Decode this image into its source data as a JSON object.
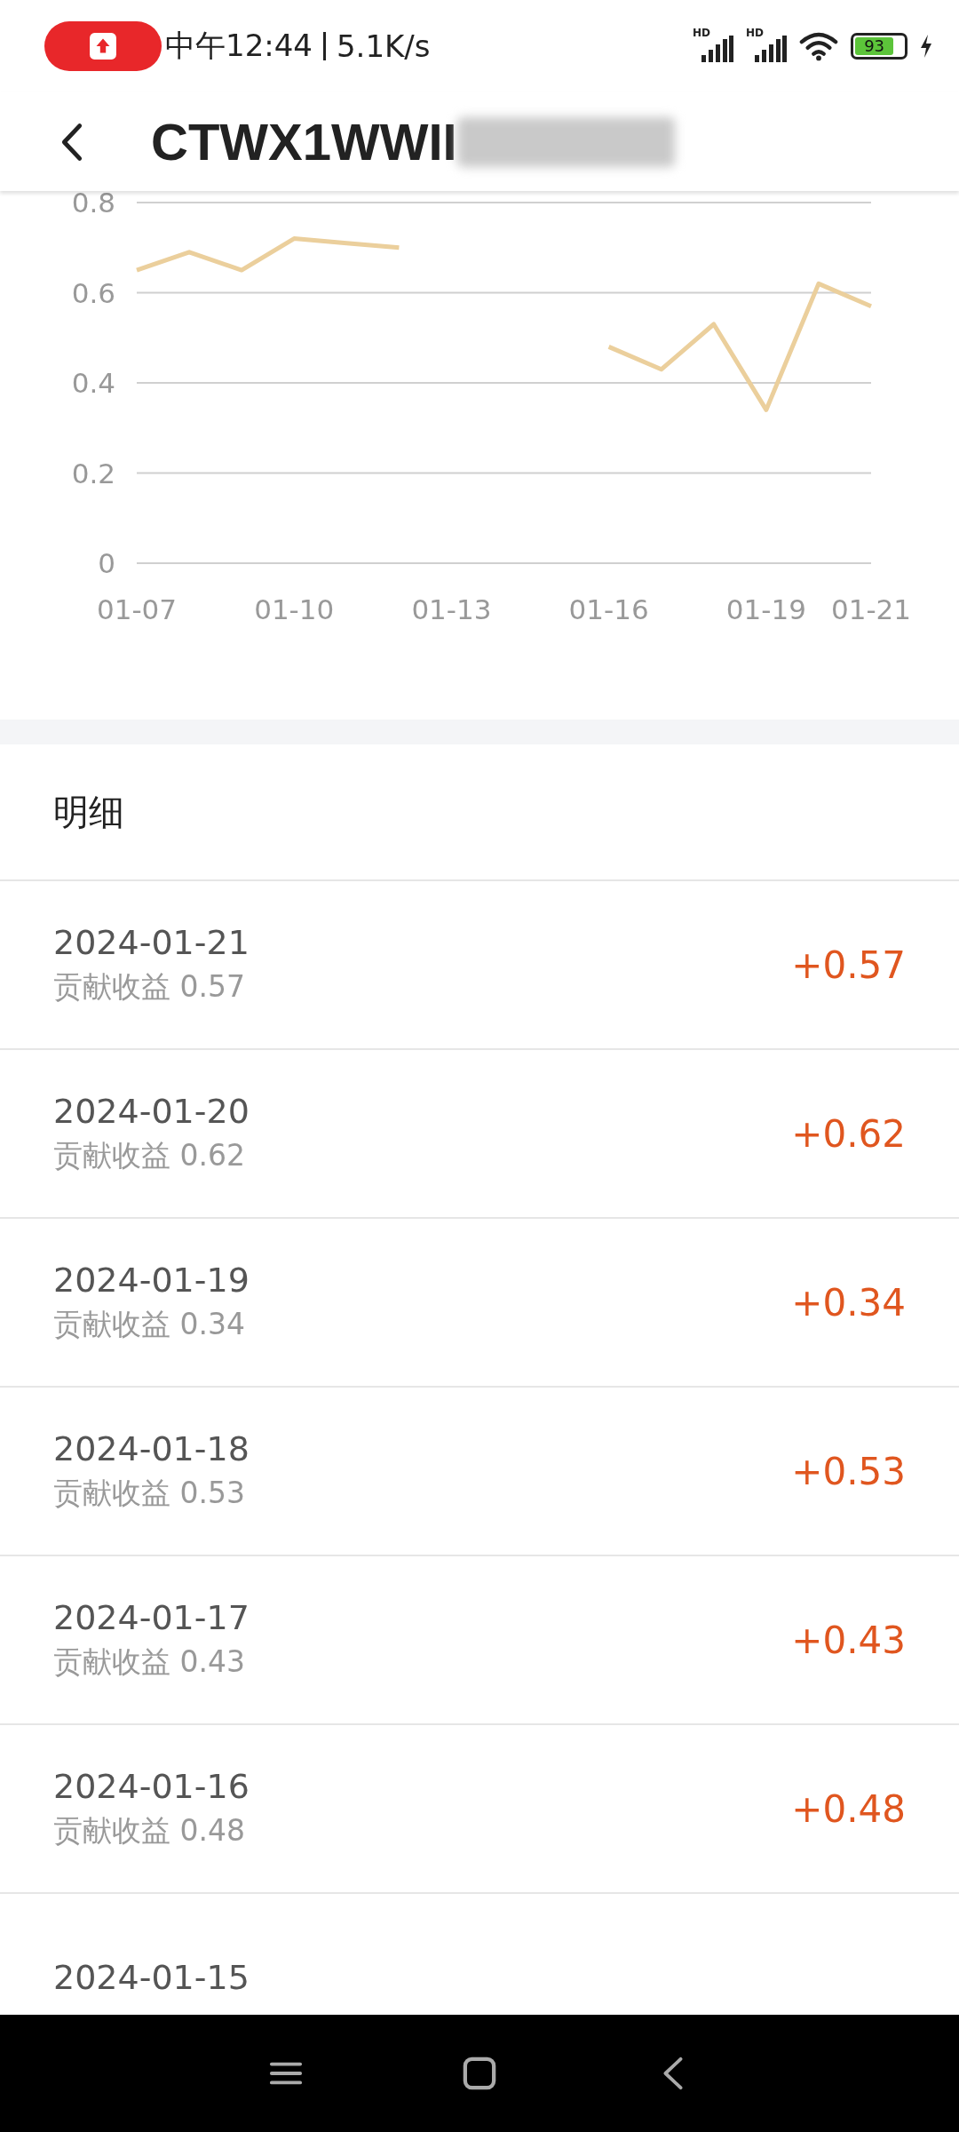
{
  "status_bar": {
    "time": "中午12:44",
    "speed": "5.1K/s",
    "battery": "93",
    "signal_labels": [
      "HD",
      "HD"
    ]
  },
  "header": {
    "title": "CTWX1WWII"
  },
  "chart_data": {
    "type": "line",
    "categories": [
      "01-07",
      null,
      null,
      "01-10",
      null,
      null,
      "01-13",
      null,
      null,
      "01-16",
      null,
      null,
      "01-19",
      null,
      "01-21"
    ],
    "series": [
      {
        "color": "#ebcf9c",
        "values": [
          0.65,
          0.69,
          0.65,
          0.72,
          0.71,
          0.7,
          null,
          null,
          null,
          0.48,
          0.43,
          0.53,
          0.34,
          0.62,
          0.57
        ]
      }
    ],
    "grid": true,
    "yticks": [
      0,
      0.2,
      0.4,
      0.6,
      0.8
    ],
    "ylim": [
      0,
      0.8
    ]
  },
  "details": {
    "title": "明细",
    "rows": [
      {
        "date": "2024-01-21",
        "note": "贡献收益 0.57",
        "amount": "+0.57"
      },
      {
        "date": "2024-01-20",
        "note": "贡献收益 0.62",
        "amount": "+0.62"
      },
      {
        "date": "2024-01-19",
        "note": "贡献收益 0.34",
        "amount": "+0.34"
      },
      {
        "date": "2024-01-18",
        "note": "贡献收益 0.53",
        "amount": "+0.53"
      },
      {
        "date": "2024-01-17",
        "note": "贡献收益 0.43",
        "amount": "+0.43"
      },
      {
        "date": "2024-01-16",
        "note": "贡献收益 0.48",
        "amount": "+0.48"
      },
      {
        "date": "2024-01-15"
      }
    ]
  }
}
